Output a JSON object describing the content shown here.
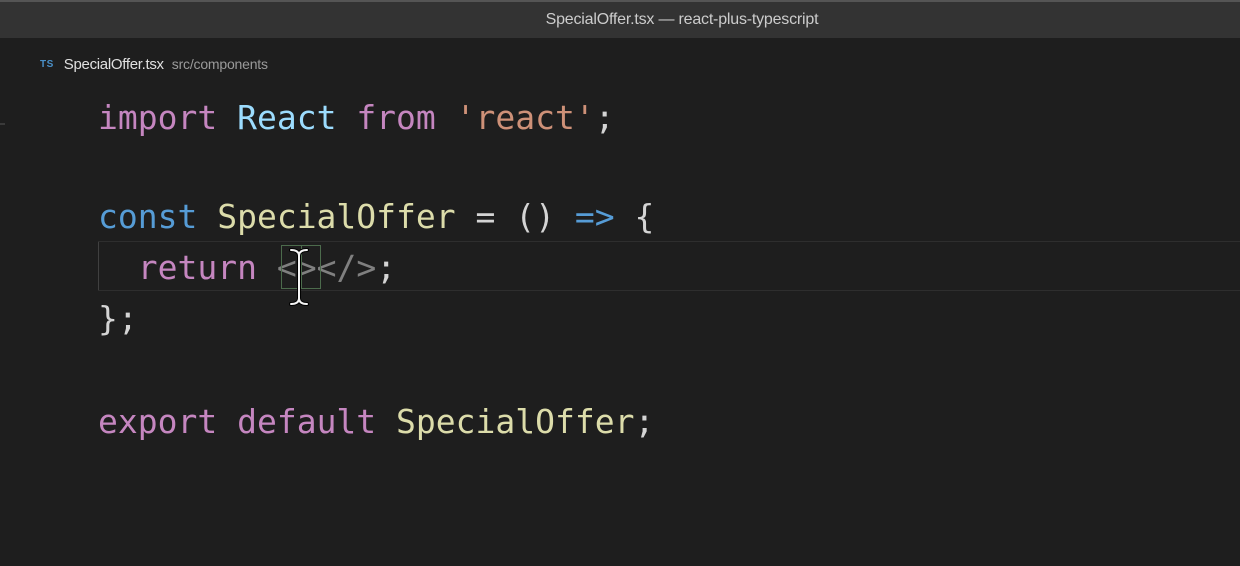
{
  "window": {
    "title": "SpecialOffer.tsx — react-plus-typescript"
  },
  "breadcrumb": {
    "file_icon": "TS",
    "file_name": "SpecialOffer.tsx",
    "path": "src/components"
  },
  "editor": {
    "lines": {
      "l1": {
        "kw_import": "import",
        "sp1": " ",
        "ident_react": "React",
        "sp2": " ",
        "kw_from": "from",
        "sp3": " ",
        "str": "'react'",
        "semi": ";"
      },
      "l3": {
        "kw_const": "const",
        "sp1": " ",
        "ident": "SpecialOffer",
        "rest": " = () ",
        "arrow": "=>",
        "brace": " {"
      },
      "l4": {
        "indent": "  ",
        "kw_return": "return",
        "sp1": " ",
        "frag": "<></>",
        "semi": ";"
      },
      "l5": {
        "close": "};"
      },
      "l7": {
        "kw_export": "export",
        "sp1": " ",
        "kw_default": "default",
        "sp2": " ",
        "ident": "SpecialOffer",
        "semi": ";"
      }
    },
    "colors": {
      "keyword_control": "#c586c0",
      "keyword_storage": "#569cd6",
      "type_identifier": "#9cdcfe",
      "function_identifier": "#dcdcaa",
      "string": "#ce9178",
      "background": "#1e1e1e"
    },
    "cursor_icon": "text-i-beam-cursor-icon"
  }
}
